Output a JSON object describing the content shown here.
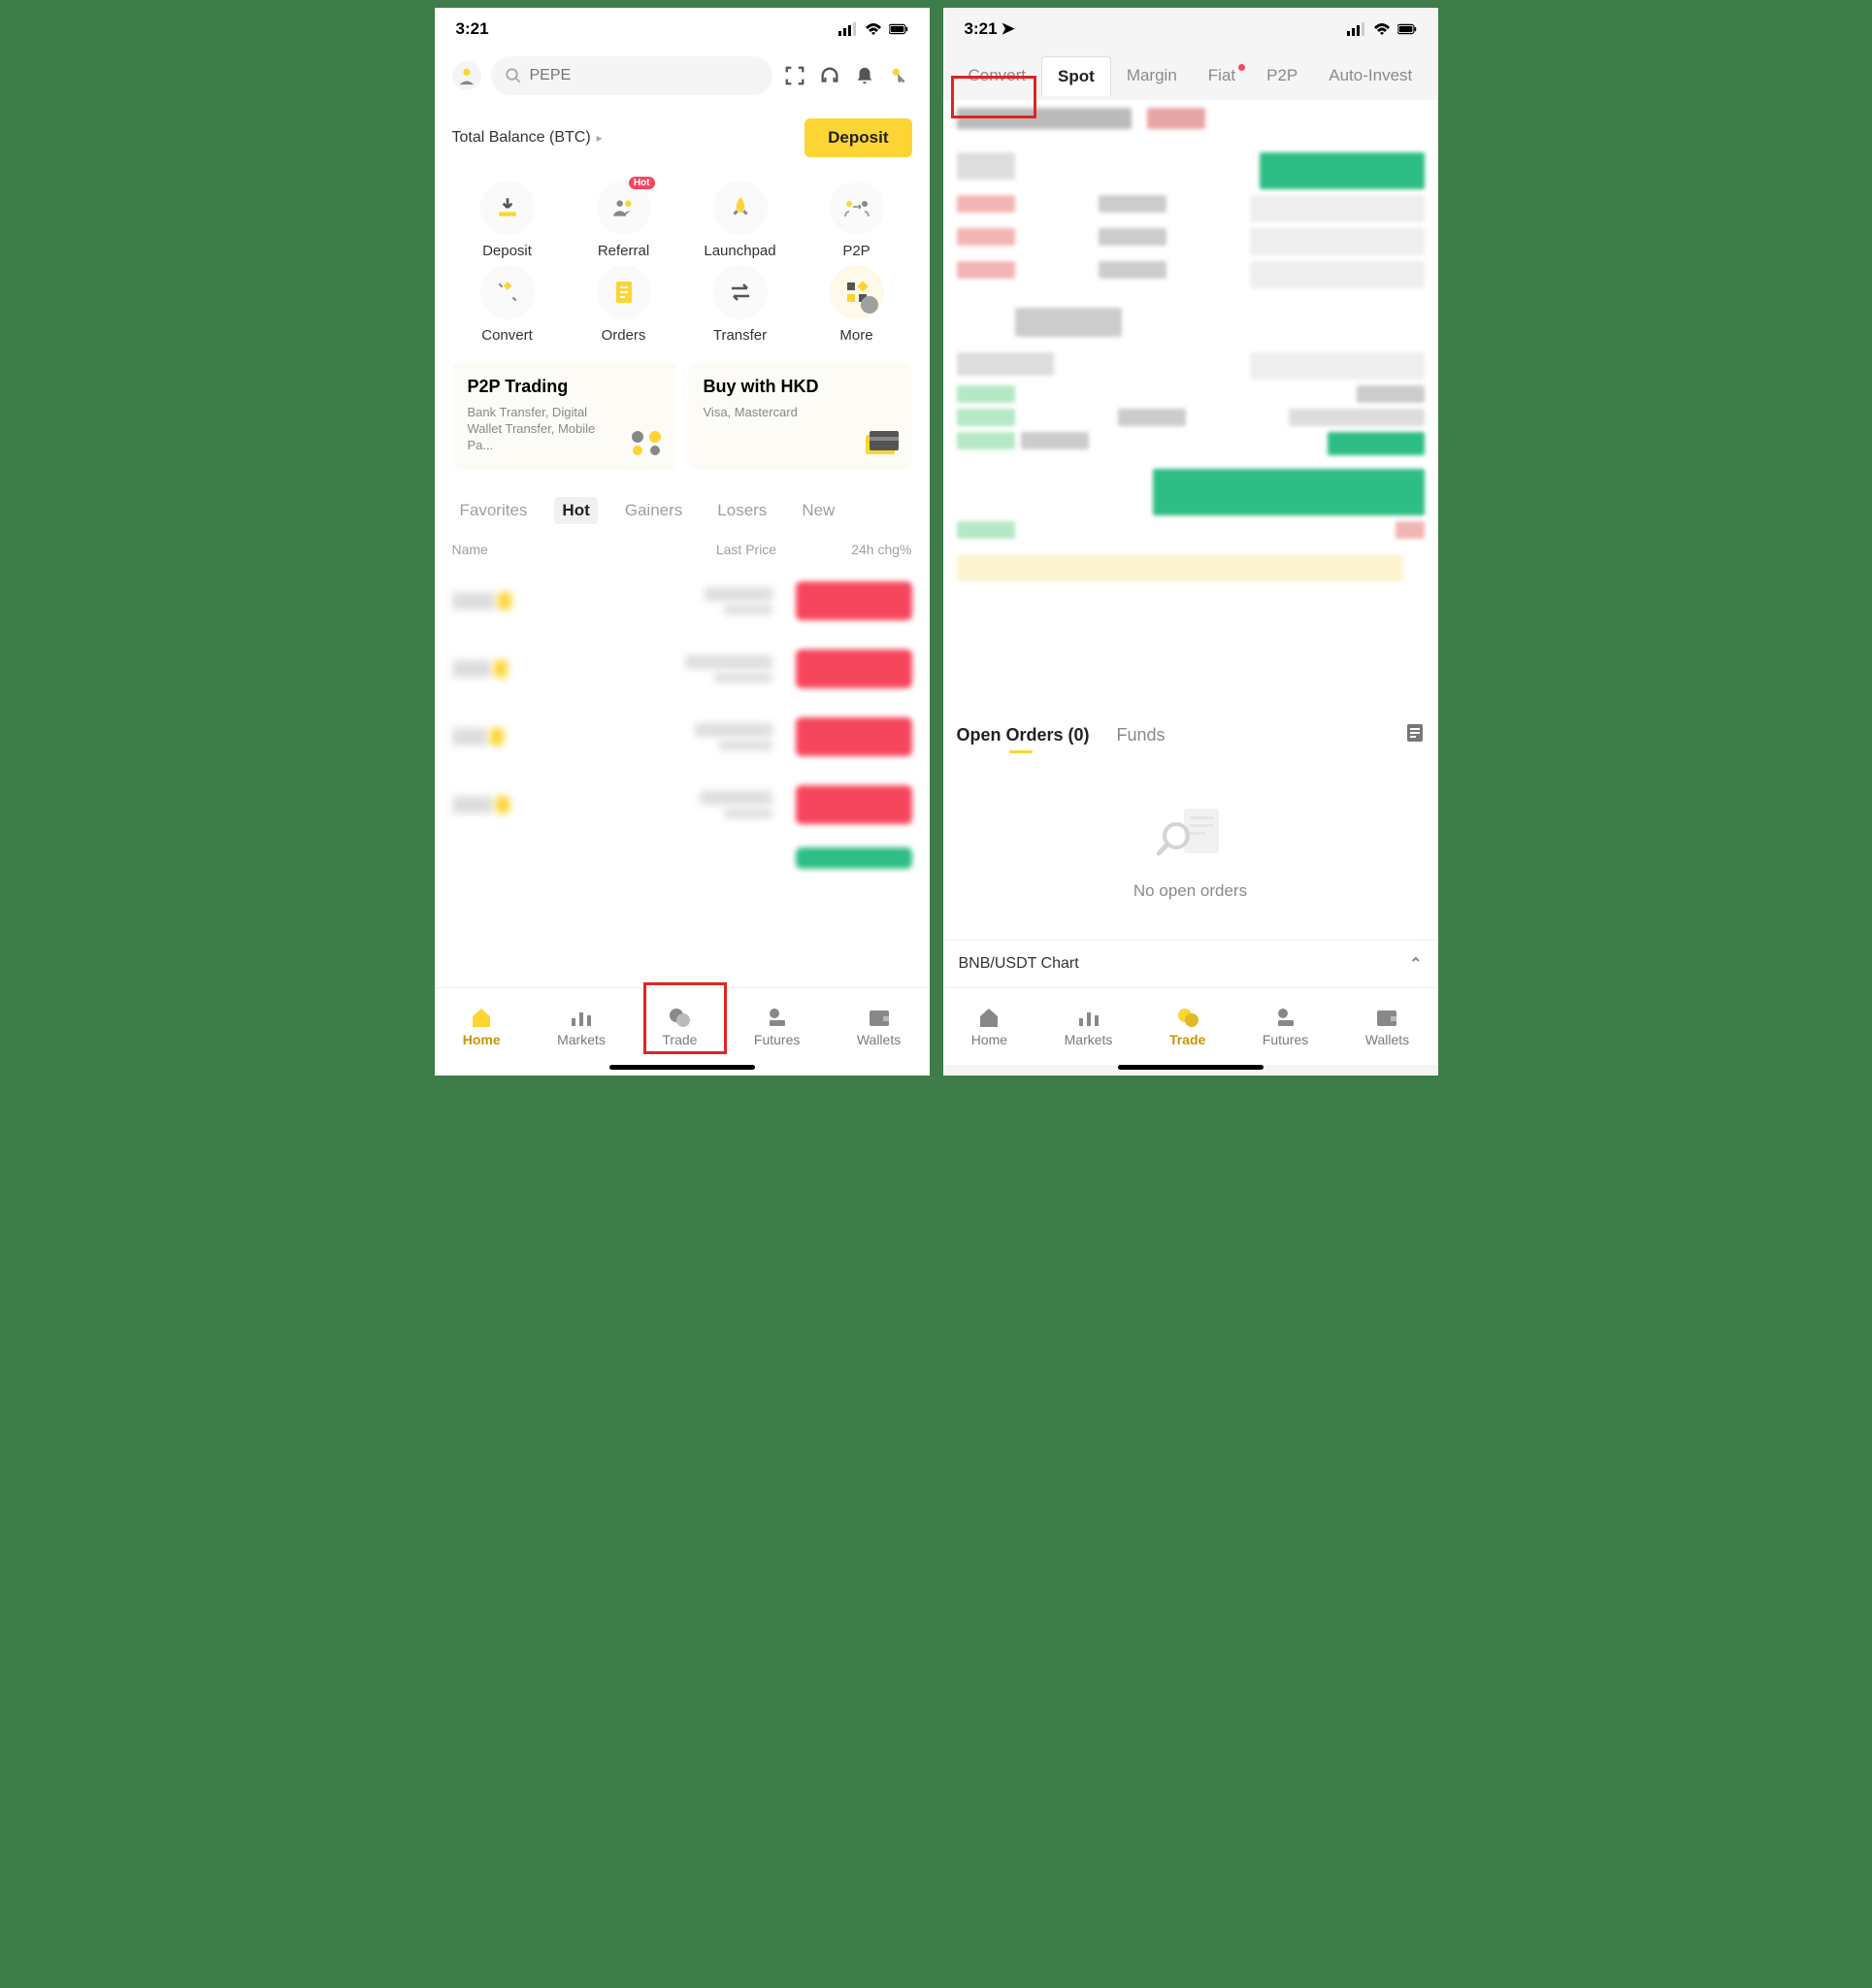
{
  "left": {
    "status_time": "3:21",
    "search_placeholder": "PEPE",
    "balance_label": "Total Balance (BTC)",
    "deposit_button": "Deposit",
    "quick_actions": [
      {
        "label": "Deposit",
        "icon": "download"
      },
      {
        "label": "Referral",
        "icon": "people",
        "badge": "Hot"
      },
      {
        "label": "Launchpad",
        "icon": "rocket"
      },
      {
        "label": "P2P",
        "icon": "p2p"
      },
      {
        "label": "Convert",
        "icon": "convert"
      },
      {
        "label": "Orders",
        "icon": "orders"
      },
      {
        "label": "Transfer",
        "icon": "transfer"
      },
      {
        "label": "More",
        "icon": "more"
      }
    ],
    "promo_cards": [
      {
        "title": "P2P Trading",
        "sub": "Bank Transfer, Digital Wallet Transfer, Mobile Pa..."
      },
      {
        "title": "Buy with HKD",
        "sub": "Visa, Mastercard"
      }
    ],
    "market_tabs": [
      "Favorites",
      "Hot",
      "Gainers",
      "Losers",
      "New"
    ],
    "market_tabs_active": "Hot",
    "market_header": {
      "name": "Name",
      "price": "Last Price",
      "chg": "24h chg%"
    },
    "bottom_nav": [
      "Home",
      "Markets",
      "Trade",
      "Futures",
      "Wallets"
    ],
    "bottom_nav_active": "Home"
  },
  "right": {
    "status_time": "3:21",
    "trade_tabs": [
      "Convert",
      "Spot",
      "Margin",
      "Fiat",
      "P2P",
      "Auto-Invest"
    ],
    "trade_tabs_selected": "Spot",
    "trade_tabs_highlighted": "Convert",
    "trade_tabs_dot": "Fiat",
    "orders_tabs": {
      "open": "Open Orders (0)",
      "funds": "Funds"
    },
    "no_orders_text": "No open orders",
    "chart_label": "BNB/USDT Chart",
    "bottom_nav": [
      "Home",
      "Markets",
      "Trade",
      "Futures",
      "Wallets"
    ],
    "bottom_nav_active": "Trade"
  }
}
